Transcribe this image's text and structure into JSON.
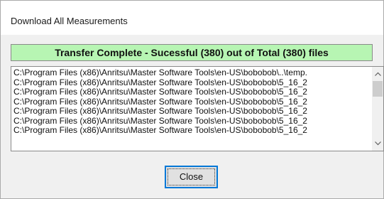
{
  "window": {
    "title": "Download All Measurements"
  },
  "status": {
    "text": "Transfer Complete - Sucessful (380) out of Total (380) files",
    "color": "#b7f5b3"
  },
  "file_list": {
    "items": [
      "C:\\Program Files (x86)\\Anritsu\\Master Software Tools\\en-US\\bobobob\\..\\temp.",
      "C:\\Program Files (x86)\\Anritsu\\Master Software Tools\\en-US\\bobobob\\5_16_2",
      "C:\\Program Files (x86)\\Anritsu\\Master Software Tools\\en-US\\bobobob\\5_16_2",
      "C:\\Program Files (x86)\\Anritsu\\Master Software Tools\\en-US\\bobobob\\5_16_2",
      "C:\\Program Files (x86)\\Anritsu\\Master Software Tools\\en-US\\bobobob\\5_16_2",
      "C:\\Program Files (x86)\\Anritsu\\Master Software Tools\\en-US\\bobobob\\5_16_2",
      "C:\\Program Files (x86)\\Anritsu\\Master Software Tools\\en-US\\bobobob\\5_16_2"
    ],
    "scroll_up_icon": "chevron-up-icon",
    "scroll_down_icon": "chevron-down-icon"
  },
  "buttons": {
    "close_label": "Close"
  },
  "colors": {
    "accent": "#0078d7"
  }
}
